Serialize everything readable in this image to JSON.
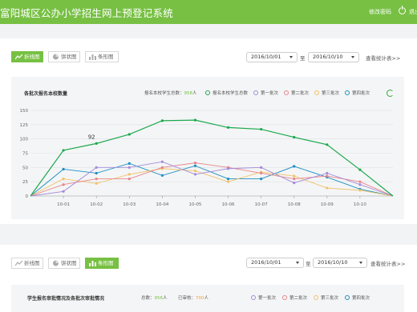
{
  "header": {
    "title": "富阳城区公办小学招生网上预登记系统",
    "change_password": "修改密码",
    "logout": "退出"
  },
  "section1": {
    "tabs": [
      {
        "label": "折线图",
        "active": true
      },
      {
        "label": "饼状图",
        "active": false
      },
      {
        "label": "条形图",
        "active": false
      }
    ],
    "date_from": "2016/10/01",
    "date_sep": "至",
    "date_to": "2016/10/10",
    "view_stats": "查看统计表>>",
    "chart_title": "各批次报名本校数量",
    "summary_label": "报名本校学生总数：",
    "summary_value": "958",
    "summary_unit": "人",
    "legend": [
      {
        "name": "报名本校学生总数",
        "color": "#1aa94d"
      },
      {
        "name": "第一批次",
        "color": "#a48cd8"
      },
      {
        "name": "第二批次",
        "color": "#e8858a"
      },
      {
        "name": "第三批次",
        "color": "#f0c36a"
      },
      {
        "name": "第四批次",
        "color": "#1a8fc4"
      }
    ]
  },
  "chart_data": {
    "type": "line",
    "categories": [
      "10-01",
      "10-02",
      "10-03",
      "10-04",
      "10-05",
      "10-06",
      "10-07",
      "10-08",
      "10-09",
      "10-10"
    ],
    "ylim": [
      0,
      150
    ],
    "yticks": [
      0,
      25,
      50,
      75,
      100,
      125,
      150
    ],
    "grid": true,
    "tooltip": {
      "index": 2,
      "value": "92"
    },
    "series": [
      {
        "name": "报名本校学生总数",
        "color": "#1aa94d",
        "values": [
          0,
          80,
          92,
          108,
          132,
          133,
          120,
          117,
          103,
          90,
          46,
          0
        ]
      },
      {
        "name": "第一批次",
        "color": "#a48cd8",
        "values": [
          0,
          8,
          50,
          50,
          60,
          38,
          48,
          50,
          23,
          40,
          20,
          0
        ]
      },
      {
        "name": "第二批次",
        "color": "#e8858a",
        "values": [
          0,
          20,
          30,
          30,
          50,
          58,
          50,
          40,
          30,
          35,
          25,
          0
        ]
      },
      {
        "name": "第三批次",
        "color": "#f0c36a",
        "values": [
          0,
          30,
          22,
          38,
          48,
          44,
          25,
          42,
          35,
          14,
          10,
          0
        ]
      },
      {
        "name": "第四批次",
        "color": "#1a8fc4",
        "values": [
          0,
          47,
          40,
          57,
          36,
          53,
          30,
          30,
          52,
          33,
          12,
          0
        ]
      }
    ]
  },
  "section2": {
    "tabs": [
      {
        "label": "折线图",
        "active": false
      },
      {
        "label": "饼状图",
        "active": false
      },
      {
        "label": "条形图",
        "active": true
      }
    ],
    "date_from": "2016/10/01",
    "date_sep": "至",
    "date_to": "2016/10/10",
    "view_stats": "查看统计表>>",
    "chart_title": "学生报名审批情况及各批次审批情况",
    "total_label": "总数：",
    "total_value": "956",
    "total_unit": "人",
    "reviewed_label": "已审核：",
    "reviewed_value": "700",
    "reviewed_unit": "人",
    "legend": [
      {
        "name": "第一批次",
        "color": "#a48cd8"
      },
      {
        "name": "第二批次",
        "color": "#e8858a"
      },
      {
        "name": "第三批次",
        "color": "#f0c36a"
      },
      {
        "name": "第四批次",
        "color": "#1a8fc4"
      }
    ]
  }
}
